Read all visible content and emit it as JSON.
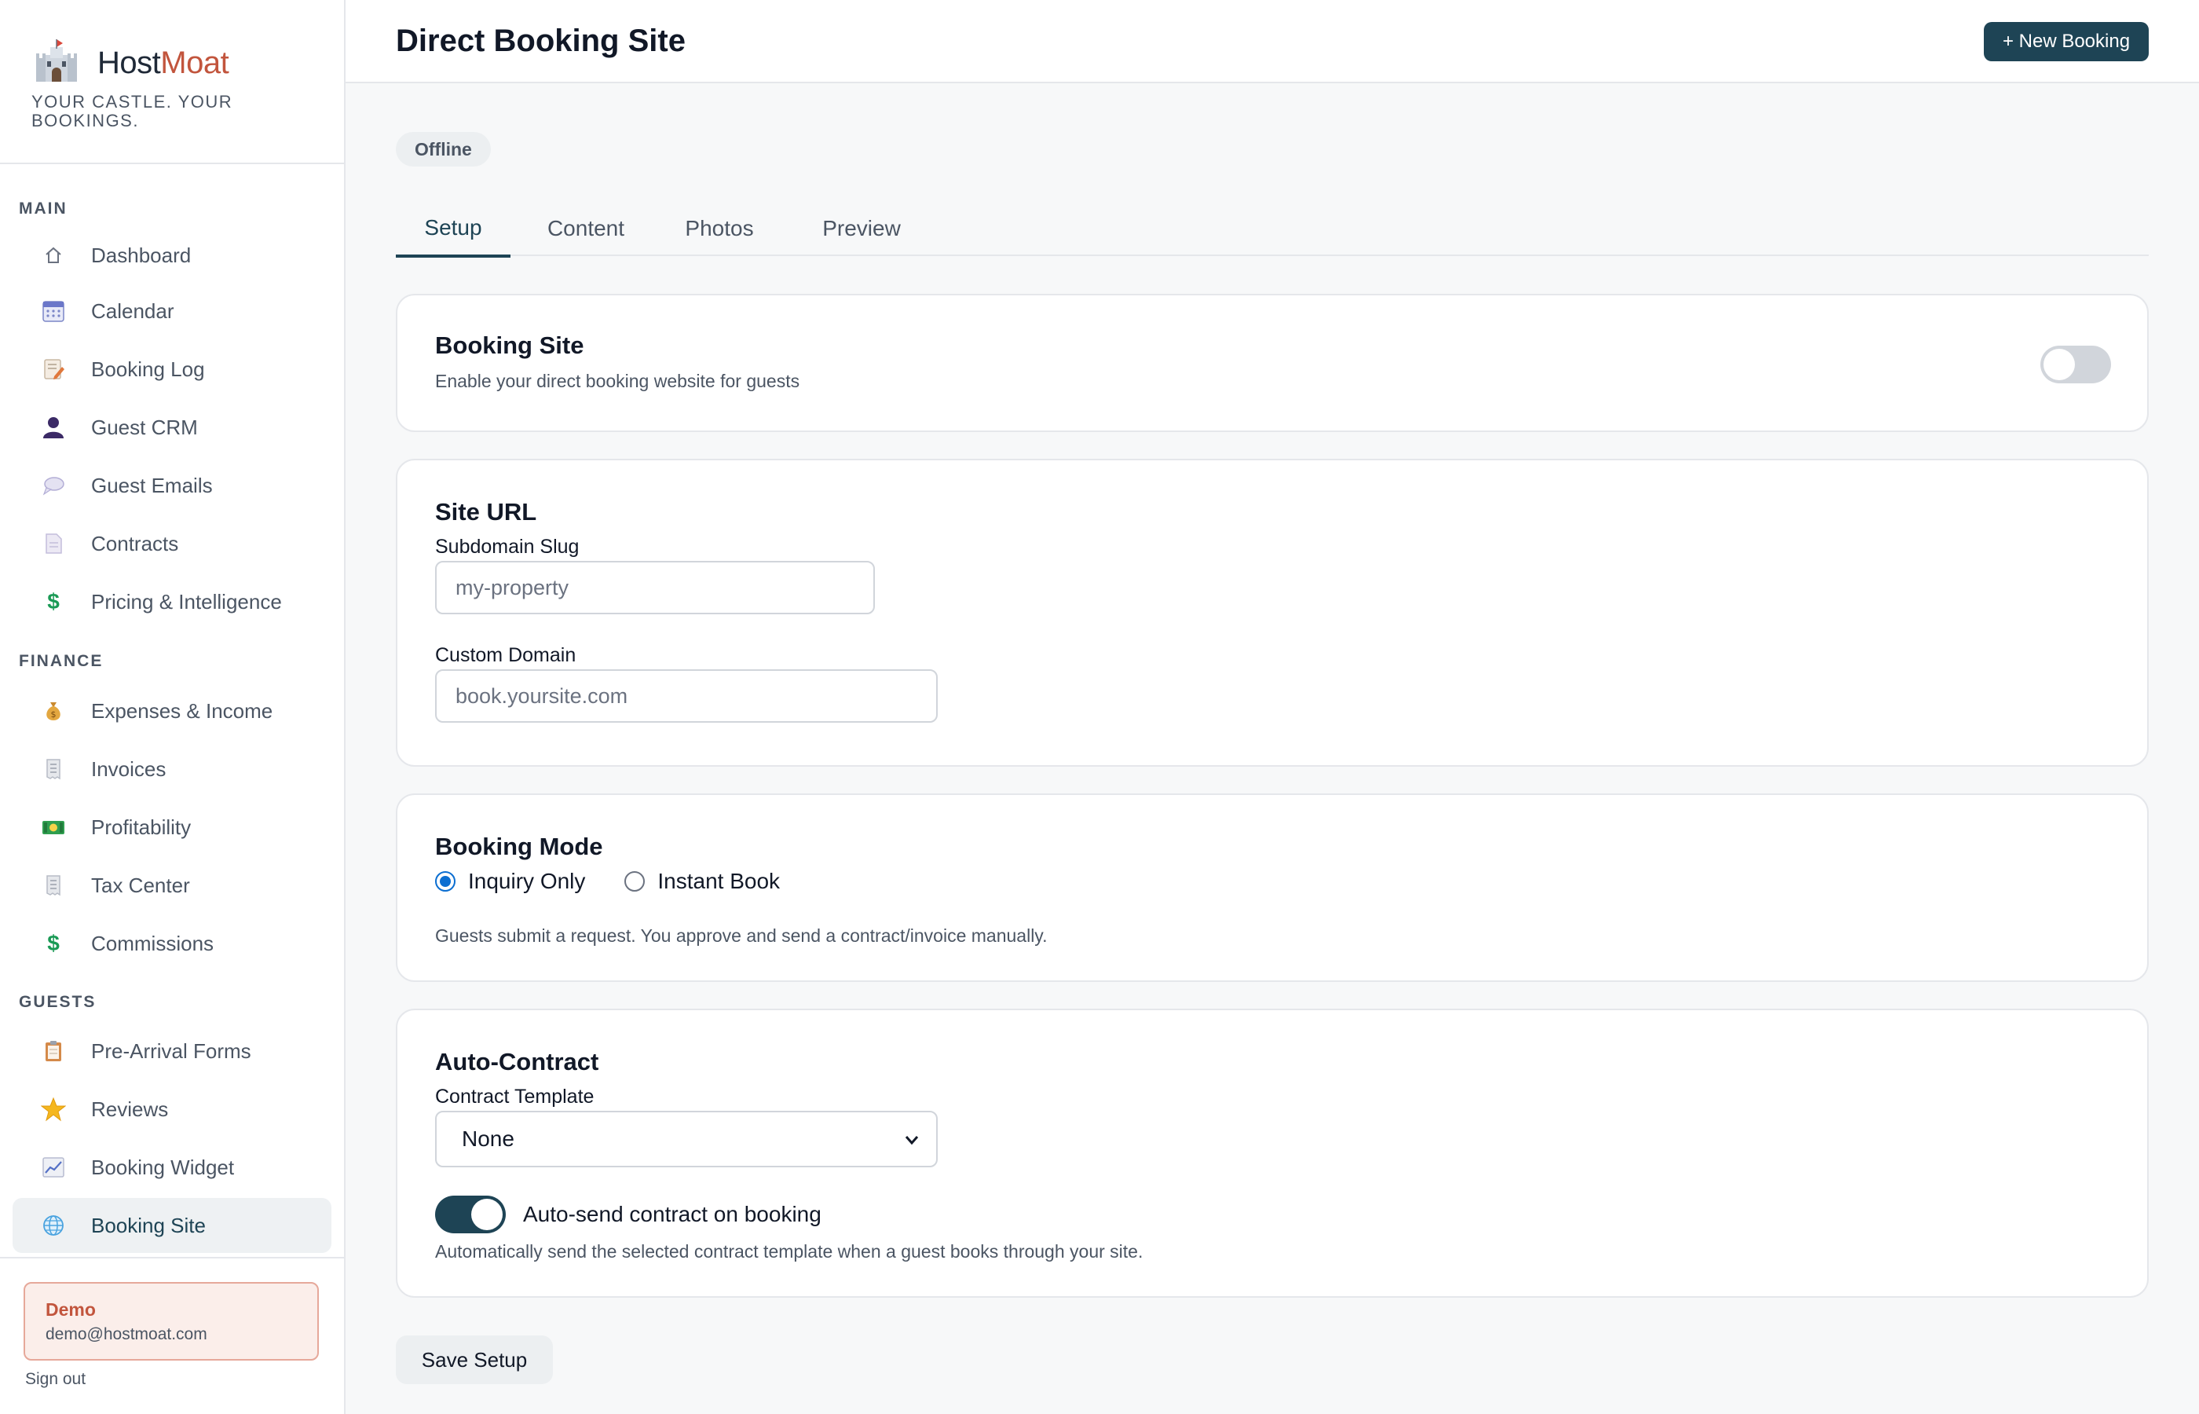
{
  "brand": {
    "name_host": "Host",
    "name_moat": "Moat",
    "tagline": "YOUR CASTLE. YOUR BOOKINGS."
  },
  "sidebar": {
    "sections": [
      {
        "heading": "MAIN",
        "items": [
          {
            "label": "Dashboard",
            "icon": "home-icon"
          },
          {
            "label": "Calendar",
            "icon": "calendar-icon"
          },
          {
            "label": "Booking Log",
            "icon": "memo-icon"
          },
          {
            "label": "Guest CRM",
            "icon": "person-icon"
          },
          {
            "label": "Guest Emails",
            "icon": "speech-bubble-icon"
          },
          {
            "label": "Contracts",
            "icon": "document-icon"
          },
          {
            "label": "Pricing & Intelligence",
            "icon": "dollar-icon"
          }
        ]
      },
      {
        "heading": "FINANCE",
        "items": [
          {
            "label": "Expenses & Income",
            "icon": "money-bag-icon"
          },
          {
            "label": "Invoices",
            "icon": "receipt-icon"
          },
          {
            "label": "Profitability",
            "icon": "banknote-icon"
          },
          {
            "label": "Tax Center",
            "icon": "receipt-icon"
          },
          {
            "label": "Commissions",
            "icon": "dollar-icon"
          }
        ]
      },
      {
        "heading": "GUESTS",
        "items": [
          {
            "label": "Pre-Arrival Forms",
            "icon": "clipboard-icon"
          },
          {
            "label": "Reviews",
            "icon": "star-icon"
          },
          {
            "label": "Booking Widget",
            "icon": "chart-icon"
          },
          {
            "label": "Booking Site",
            "icon": "globe-icon",
            "active": true
          }
        ]
      }
    ],
    "user": {
      "name": "Demo",
      "email": "demo@hostmoat.com"
    },
    "signout_label": "Sign out"
  },
  "header": {
    "title": "Direct Booking Site",
    "new_booking_label": "+ New Booking"
  },
  "main": {
    "status": "Offline",
    "tabs": [
      {
        "label": "Setup",
        "active": true
      },
      {
        "label": "Content"
      },
      {
        "label": "Photos"
      },
      {
        "label": "Preview"
      }
    ],
    "booking_site": {
      "title": "Booking Site",
      "description": "Enable your direct booking website for guests",
      "enabled": false
    },
    "site_url": {
      "title": "Site URL",
      "subdomain_label": "Subdomain Slug",
      "subdomain_placeholder": "my-property",
      "custom_domain_label": "Custom Domain",
      "custom_domain_placeholder": "book.yoursite.com"
    },
    "booking_mode": {
      "title": "Booking Mode",
      "options": [
        "Inquiry Only",
        "Instant Book"
      ],
      "selected": "Inquiry Only",
      "description": "Guests submit a request. You approve and send a contract/invoice manually."
    },
    "auto_contract": {
      "title": "Auto-Contract",
      "template_label": "Contract Template",
      "template_value": "None",
      "autosend_label": "Auto-send contract on booking",
      "autosend_enabled": true,
      "autosend_description": "Automatically send the selected contract template when a guest books through your site."
    },
    "save_label": "Save Setup"
  },
  "colors": {
    "accent": "#1e4455",
    "brand_moat": "#c2553d",
    "radio_selected": "#0b6ed1"
  }
}
